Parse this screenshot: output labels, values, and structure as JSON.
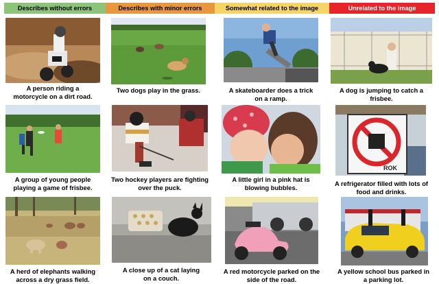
{
  "headers": [
    {
      "label": "Describes without errors",
      "color": "#8cc47a"
    },
    {
      "label": "Describes with minor errors",
      "color": "#e9973f"
    },
    {
      "label": "Somewhat related to the image",
      "color": "#f6d566"
    },
    {
      "label": "Unrelated to the image",
      "color": "#e8242b"
    }
  ],
  "captions": [
    [
      "A person riding a",
      "motorcycle on a dirt road."
    ],
    [
      "Two dogs play in the grass."
    ],
    [
      "A skateboarder does a trick",
      "on a ramp."
    ],
    [
      "A dog is jumping to catch a",
      "frisbee."
    ],
    [
      "A group of young people",
      "playing a game of frisbee."
    ],
    [
      "Two hockey players are fighting",
      "over the puck."
    ],
    [
      "A little girl in a pink hat is",
      "blowing bubbles."
    ],
    [
      "A refrigerator filled with lots of",
      "food and drinks."
    ],
    [
      "A herd of elephants walking",
      "across a dry grass field."
    ],
    [
      "A close up of a cat laying",
      "on a couch."
    ],
    [
      "A red motorcycle parked on the",
      "side of the road."
    ],
    [
      "A yellow school bus parked in",
      "a parking lot."
    ]
  ],
  "sign_text": "ROK"
}
